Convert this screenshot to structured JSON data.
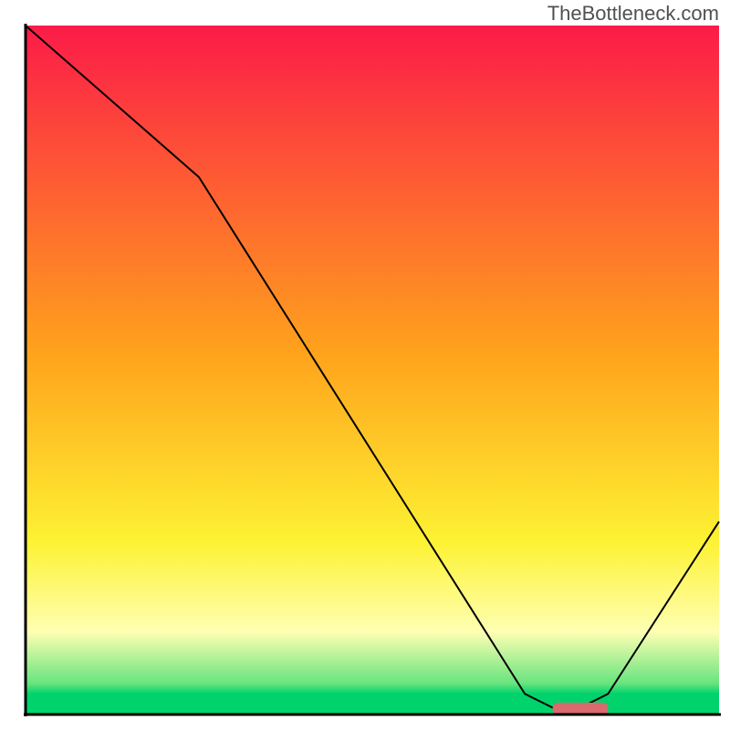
{
  "attribution": "TheBottleneck.com",
  "chart_data": {
    "type": "line",
    "title": "",
    "xlabel": "",
    "ylabel": "",
    "xlim": [
      0,
      100
    ],
    "ylim": [
      0,
      100
    ],
    "grid": false,
    "legend": false,
    "series": [
      {
        "name": "bottleneck-curve",
        "x": [
          0,
          25,
          72,
          76,
          80,
          84,
          100
        ],
        "y": [
          100,
          78,
          3,
          1,
          1,
          3,
          28
        ]
      }
    ],
    "marker": {
      "name": "sweet-spot",
      "x_start": 76,
      "x_end": 84,
      "y": 0.8,
      "color": "#d96a6d"
    },
    "background_gradient": {
      "stops": [
        {
          "offset": 0.0,
          "color": "#fc1b48"
        },
        {
          "offset": 0.48,
          "color": "#ffa41c"
        },
        {
          "offset": 0.75,
          "color": "#fdf233"
        },
        {
          "offset": 0.88,
          "color": "#feffb3"
        },
        {
          "offset": 0.955,
          "color": "#68e47e"
        },
        {
          "offset": 0.97,
          "color": "#00d36c"
        },
        {
          "offset": 1.0,
          "color": "#00d36c"
        }
      ]
    },
    "axis_color": "#000000",
    "curve_color": "#000000"
  }
}
